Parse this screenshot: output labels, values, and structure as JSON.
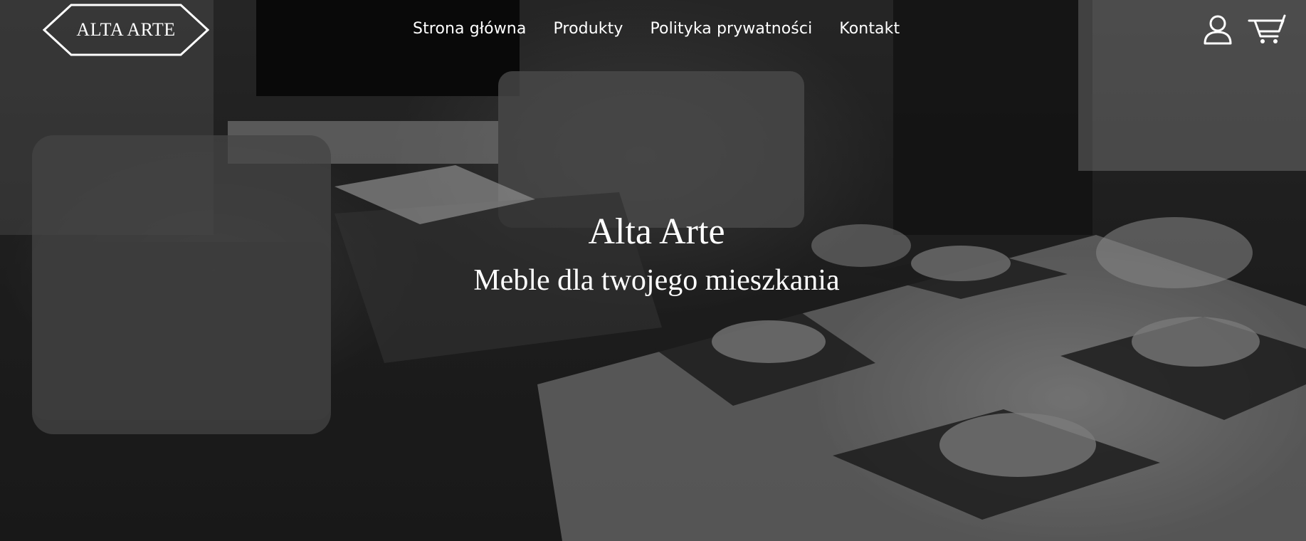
{
  "header": {
    "logo_text": "ALTA ARTE",
    "nav": [
      {
        "label": "Strona główna"
      },
      {
        "label": "Produkty"
      },
      {
        "label": "Polityka prywatności"
      },
      {
        "label": "Kontakt"
      }
    ],
    "icons": {
      "account": "user-icon",
      "cart": "cart-icon"
    }
  },
  "hero": {
    "title": "Alta Arte",
    "subtitle": "Meble dla twojego mieszkania",
    "background": "living-room-photo"
  },
  "colors": {
    "text": "#ffffff",
    "overlay": "rgba(0,0,0,0.35)"
  }
}
